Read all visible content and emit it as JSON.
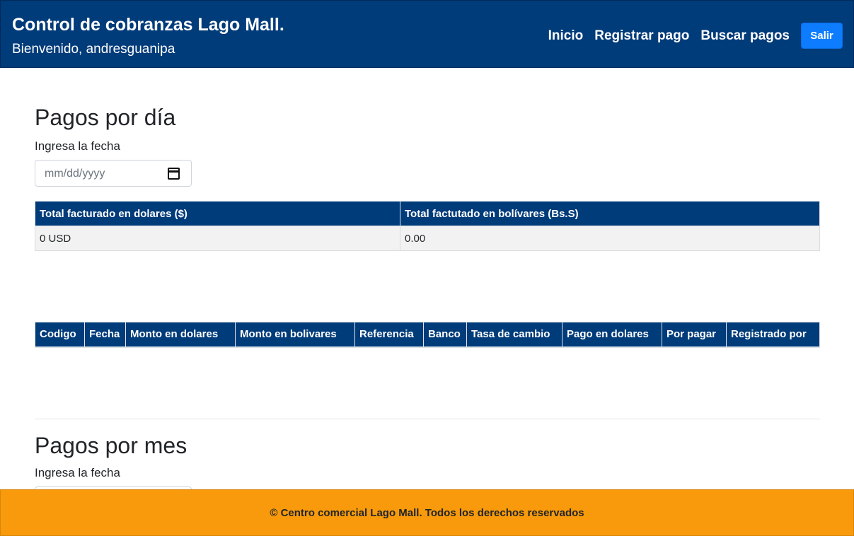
{
  "header": {
    "title": "Control de cobranzas Lago Mall.",
    "welcome": "Bienvenido, andresguanipa",
    "nav": [
      "Inicio",
      "Registrar pago",
      "Buscar pagos"
    ],
    "logout_label": "Salir"
  },
  "daily": {
    "title": "Pagos por día",
    "date_label": "Ingresa la fecha",
    "date_placeholder": "mm/dd/yyyy",
    "totals": {
      "headers": [
        "Total facturado en dolares ($)",
        "Total factutado en bolívares (Bs.S)"
      ],
      "values": [
        "0 USD",
        "0.00"
      ]
    },
    "payments_columns": [
      "Codigo",
      "Fecha",
      "Monto en dolares",
      "Monto en bolivares",
      "Referencia",
      "Banco",
      "Tasa de cambio",
      "Pago en dolares",
      "Por pagar",
      "Registrado por"
    ]
  },
  "monthly": {
    "title": "Pagos por mes",
    "date_label": "Ingresa la fecha"
  },
  "footer": {
    "text": "© Centro comercial Lago Mall. Todos los derechos reservados"
  },
  "colors": {
    "navbar": "#003b7a",
    "button": "#0d7cff",
    "footer": "#f89a0b"
  }
}
